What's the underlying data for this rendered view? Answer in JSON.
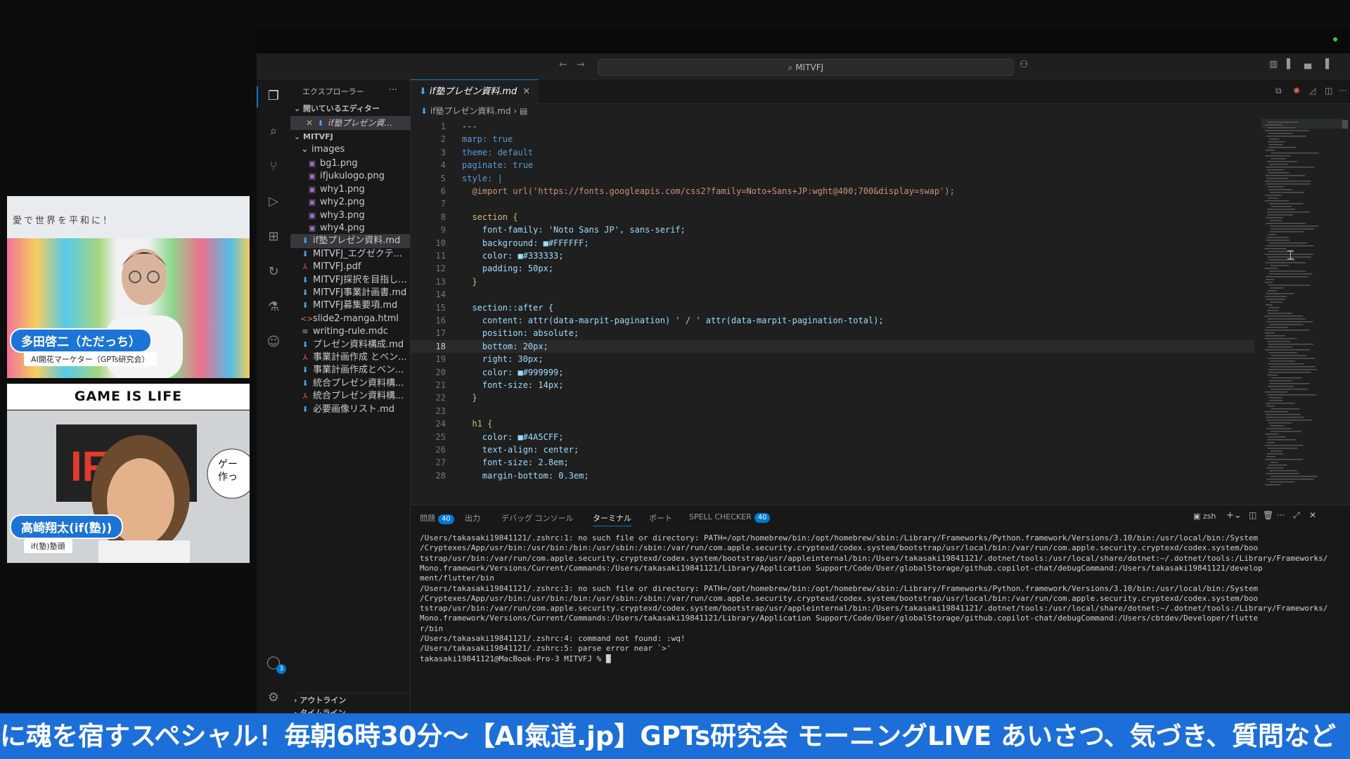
{
  "stream": {
    "guest1": {
      "slogan": "愛で世界を平和に！",
      "name": "多田啓二（ただっち）",
      "title": "AI開花マーケター（GPTs研究会）"
    },
    "banner": "GAME IS LIFE",
    "guest2": {
      "name": "高崎翔太(if(塾))",
      "title": "if(塾)塾頭",
      "speech": "ゲー\n作っ"
    },
    "ticker": "に魂を宿すスペシャル！毎朝6時30分〜【AI氣道.jp】GPTs研究会 モーニングLIVE あいさつ、気づき、質問など"
  },
  "titlebar": {
    "search": "MITVFJ"
  },
  "sidebar": {
    "title": "エクスプローラー",
    "open_editors": "開いているエディター",
    "open_file": "if塾プレゼン資...",
    "root": "MITVFJ",
    "folder": "images",
    "files": [
      {
        "name": "bg1.png",
        "icon": "image-file-icon",
        "indent": 1
      },
      {
        "name": "ifjukulogo.png",
        "icon": "image-file-icon",
        "indent": 1
      },
      {
        "name": "why1.png",
        "icon": "image-file-icon",
        "indent": 1
      },
      {
        "name": "why2.png",
        "icon": "image-file-icon",
        "indent": 1
      },
      {
        "name": "why3.png",
        "icon": "image-file-icon",
        "indent": 1
      },
      {
        "name": "why4.png",
        "icon": "image-file-icon",
        "indent": 1
      },
      {
        "name": "if塾プレゼン資料.md",
        "icon": "markdown-file-icon",
        "indent": 0,
        "selected": true
      },
      {
        "name": "MITVFJ_エグゼクテ...",
        "icon": "markdown-file-icon",
        "indent": 0
      },
      {
        "name": "MITVFJ.pdf",
        "icon": "pdf-file-icon",
        "indent": 0
      },
      {
        "name": "MITVFJ採択を目指し...",
        "icon": "markdown-file-icon",
        "indent": 0
      },
      {
        "name": "MITVFJ事業計画書.md",
        "icon": "markdown-file-icon",
        "indent": 0
      },
      {
        "name": "MITVFJ募集要項.md",
        "icon": "markdown-file-icon",
        "indent": 0
      },
      {
        "name": "slide2-manga.html",
        "icon": "html-file-icon",
        "indent": 0
      },
      {
        "name": "writing-rule.mdc",
        "icon": "text-file-icon",
        "indent": 0
      },
      {
        "name": "プレゼン資料構成.md",
        "icon": "markdown-file-icon",
        "indent": 0
      },
      {
        "name": "事業計画作成 とベン...",
        "icon": "pdf-file-icon",
        "indent": 0
      },
      {
        "name": "事業計画作成とベン...",
        "icon": "markdown-file-icon",
        "indent": 0
      },
      {
        "name": "統合プレゼン資料構...",
        "icon": "markdown-file-icon",
        "indent": 0
      },
      {
        "name": "統合プレゼン資料構...",
        "icon": "pdf-file-icon",
        "indent": 0
      },
      {
        "name": "必要画像リスト.md",
        "icon": "markdown-file-icon",
        "indent": 0
      }
    ],
    "outline": "アウトライン",
    "timeline": "タイムライン",
    "accounts_badge": "3"
  },
  "editor": {
    "tab": "if塾プレゼン資料.md",
    "breadcrumb": "if塾プレゼン資料.md",
    "lines": [
      {
        "n": "1",
        "t": "---"
      },
      {
        "n": "2",
        "t": "marp: true"
      },
      {
        "n": "3",
        "t": "theme: default"
      },
      {
        "n": "4",
        "t": "paginate: true"
      },
      {
        "n": "5",
        "t": "style: |"
      },
      {
        "n": "6",
        "t": "  @import url('https://fonts.googleapis.com/css2?family=Noto+Sans+JP:wght@400;700&display=swap');"
      },
      {
        "n": "7",
        "t": ""
      },
      {
        "n": "8",
        "t": "  section {"
      },
      {
        "n": "9",
        "t": "    font-family: 'Noto Sans JP', sans-serif;"
      },
      {
        "n": "10",
        "t": "    background: ■#FFFFFF;"
      },
      {
        "n": "11",
        "t": "    color: ■#333333;"
      },
      {
        "n": "12",
        "t": "    padding: 50px;"
      },
      {
        "n": "13",
        "t": "  }"
      },
      {
        "n": "14",
        "t": ""
      },
      {
        "n": "15",
        "t": "  section::after {"
      },
      {
        "n": "16",
        "t": "    content: attr(data-marpit-pagination) ' / ' attr(data-marpit-pagination-total);"
      },
      {
        "n": "17",
        "t": "    position: absolute;"
      },
      {
        "n": "18",
        "t": "    bottom: 20px;"
      },
      {
        "n": "19",
        "t": "    right: 30px;"
      },
      {
        "n": "20",
        "t": "    color: ■#999999;"
      },
      {
        "n": "21",
        "t": "    font-size: 14px;"
      },
      {
        "n": "22",
        "t": "  }"
      },
      {
        "n": "23",
        "t": ""
      },
      {
        "n": "24",
        "t": "  h1 {"
      },
      {
        "n": "25",
        "t": "    color: ■#4A5CFF;"
      },
      {
        "n": "26",
        "t": "    text-align: center;"
      },
      {
        "n": "27",
        "t": "    font-size: 2.8em;"
      },
      {
        "n": "28",
        "t": "    margin-bottom: 0.3em;"
      }
    ]
  },
  "panel": {
    "tabs": [
      {
        "label": "問題",
        "badge": "40"
      },
      {
        "label": "出力"
      },
      {
        "label": "デバッグ コンソール"
      },
      {
        "label": "ターミナル",
        "active": true
      },
      {
        "label": "ポート"
      },
      {
        "label": "SPELL CHECKER",
        "badge": "40"
      }
    ],
    "shell": "zsh",
    "terminal": [
      "/Users/takasaki19841121/.zshrc:1: no such file or directory: PATH=/opt/homebrew/bin:/opt/homebrew/sbin:/Library/Frameworks/Python.framework/Versions/3.10/bin:/usr/local/bin:/System",
      "/Cryptexes/App/usr/bin:/usr/bin:/bin:/usr/sbin:/sbin:/var/run/com.apple.security.cryptexd/codex.system/bootstrap/usr/local/bin:/var/run/com.apple.security.cryptexd/codex.system/boo",
      "tstrap/usr/bin:/var/run/com.apple.security.cryptexd/codex.system/bootstrap/usr/appleinternal/bin:/Users/takasaki19841121/.dotnet/tools:/usr/local/share/dotnet:~/.dotnet/tools:/Library/Frameworks/",
      "Mono.framework/Versions/Current/Commands:/Users/takasaki19841121/Library/Application Support/Code/User/globalStorage/github.copilot-chat/debugCommand:/Users/takasaki19841121/develop",
      "ment/flutter/bin",
      "/Users/takasaki19841121/.zshrc:3: no such file or directory: PATH=/opt/homebrew/bin:/opt/homebrew/sbin:/Library/Frameworks/Python.framework/Versions/3.10/bin:/usr/local/bin:/System",
      "/Cryptexes/App/usr/bin:/usr/bin:/bin:/usr/sbin:/sbin:/var/run/com.apple.security.cryptexd/codex.system/bootstrap/usr/local/bin:/var/run/com.apple.security.cryptexd/codex.system/boo",
      "tstrap/usr/bin:/var/run/com.apple.security.cryptexd/codex.system/bootstrap/usr/appleinternal/bin:/Users/takasaki19841121/.dotnet/tools:/usr/local/share/dotnet:~/.dotnet/tools:/Library/Frameworks/",
      "Mono.framework/Versions/Current/Commands:/Users/takasaki19841121/Library/Application Support/Code/User/globalStorage/github.copilot-chat/debugCommand:/Users/cbtdev/Developer/flutte",
      "r/bin",
      "/Users/takasaki19841121/.zshrc:4: command not found: :wq!",
      "/Users/takasaki19841121/.zshrc:5: parse error near `>'",
      "takasaki19841121@MacBook-Pro-3 MITVFJ % █"
    ]
  },
  "colors": {
    "accent": "#0078d4",
    "ticker": "#1c6fd8",
    "nametag": "#1b74d6"
  }
}
